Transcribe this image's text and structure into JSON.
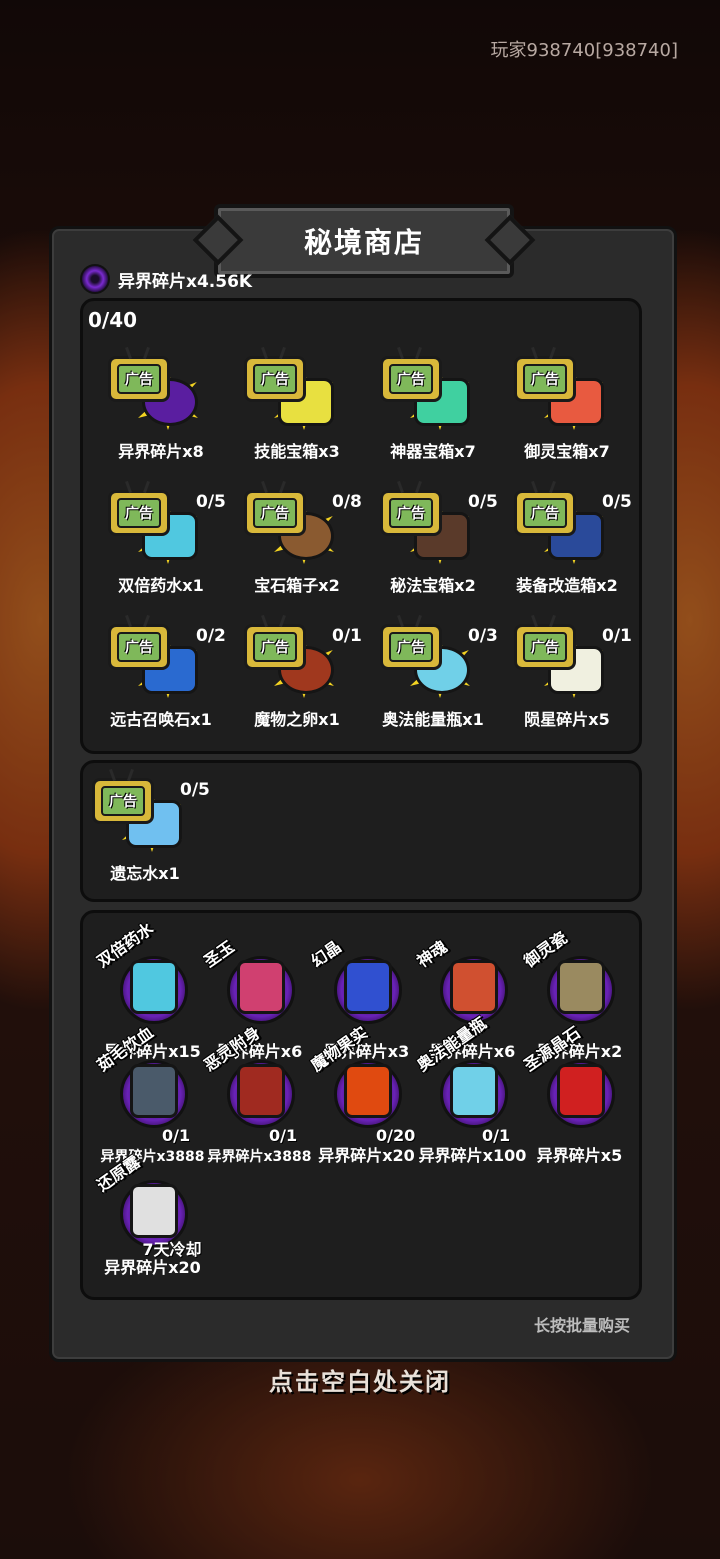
{
  "player": {
    "label": "玩家938740[938740]"
  },
  "shop": {
    "title": "秘境商店",
    "currency_label": "异界碎片x4.56K",
    "ad_counter": "0/40",
    "ad_badge": "广告",
    "ad_items": [
      {
        "name": "异界碎片x8",
        "limit": "",
        "icon": "purple-swirl-icon",
        "color": "#5a1ea0"
      },
      {
        "name": "技能宝箱x3",
        "limit": "",
        "icon": "yellow-chest-icon",
        "color": "#e8e040"
      },
      {
        "name": "神器宝箱x7",
        "limit": "",
        "icon": "teal-chest-icon",
        "color": "#40d0a0"
      },
      {
        "name": "御灵宝箱x7",
        "limit": "",
        "icon": "red-chest-icon",
        "color": "#e85a40"
      },
      {
        "name": "双倍药水x1",
        "limit": "0/5",
        "icon": "hourglass-potion-icon",
        "color": "#50c8e0"
      },
      {
        "name": "宝石箱子x2",
        "limit": "0/8",
        "icon": "gem-bag-icon",
        "color": "#8a5a30"
      },
      {
        "name": "秘法宝箱x2",
        "limit": "0/5",
        "icon": "arcane-chest-icon",
        "color": "#5a3a2a"
      },
      {
        "name": "装备改造箱x2",
        "limit": "0/5",
        "icon": "equipment-box-icon",
        "color": "#2a4a9a"
      },
      {
        "name": "远古召唤石x1",
        "limit": "0/2",
        "icon": "summon-stone-icon",
        "color": "#2a6ad0"
      },
      {
        "name": "魔物之卵x1",
        "limit": "0/1",
        "icon": "monster-egg-icon",
        "color": "#a0381e"
      },
      {
        "name": "奥法能量瓶x1",
        "limit": "0/3",
        "icon": "arcane-flask-icon",
        "color": "#70d0e8"
      },
      {
        "name": "陨星碎片x5",
        "limit": "0/1",
        "icon": "meteor-shard-icon",
        "color": "#f0f0e0"
      }
    ],
    "special_items": [
      {
        "name": "遗忘水x1",
        "limit": "0/5",
        "icon": "forget-water-icon",
        "color": "#70c0f0"
      }
    ],
    "exchange_items": [
      {
        "name": "双倍药水",
        "price": "异界碎片x15",
        "limit": "",
        "icon": "hourglass-potion-icon",
        "color": "#50c8e0"
      },
      {
        "name": "圣玉",
        "price": "异界碎片x6",
        "limit": "",
        "icon": "holy-jade-icon",
        "color": "#d04070"
      },
      {
        "name": "幻晶",
        "price": "异界碎片x3",
        "limit": "",
        "icon": "phantom-crystal-icon",
        "color": "#3050d0"
      },
      {
        "name": "神魂",
        "price": "异界碎片x6",
        "limit": "",
        "icon": "divine-soul-icon",
        "color": "#d05030"
      },
      {
        "name": "御灵瓷",
        "price": "异界碎片x2",
        "limit": "",
        "icon": "spirit-vase-icon",
        "color": "#9a8a60"
      },
      {
        "name": "茹毛饮血",
        "price": "异界碎片x3888",
        "limit": "0/1",
        "icon": "knight-icon",
        "color": "#4a5a6a"
      },
      {
        "name": "恶灵附身",
        "price": "异界碎片x3888",
        "limit": "0/1",
        "icon": "demon-icon",
        "color": "#a02a20"
      },
      {
        "name": "魔物果实",
        "price": "异界碎片x20",
        "limit": "0/20",
        "icon": "monster-fruit-icon",
        "color": "#e04a10"
      },
      {
        "name": "奥法能量瓶",
        "price": "异界碎片x100",
        "limit": "0/1",
        "icon": "arcane-flask-icon",
        "color": "#70d0e8"
      },
      {
        "name": "圣源晶石",
        "price": "异界碎片x5",
        "limit": "",
        "icon": "holy-crystal-icon",
        "color": "#d02020"
      },
      {
        "name": "还原露",
        "price": "异界碎片x20",
        "limit": "7天冷却",
        "icon": "restore-dew-icon",
        "color": "#e0e0e0"
      }
    ],
    "bulk_hint": "长按批量购买",
    "close_hint": "点击空白处关闭"
  }
}
